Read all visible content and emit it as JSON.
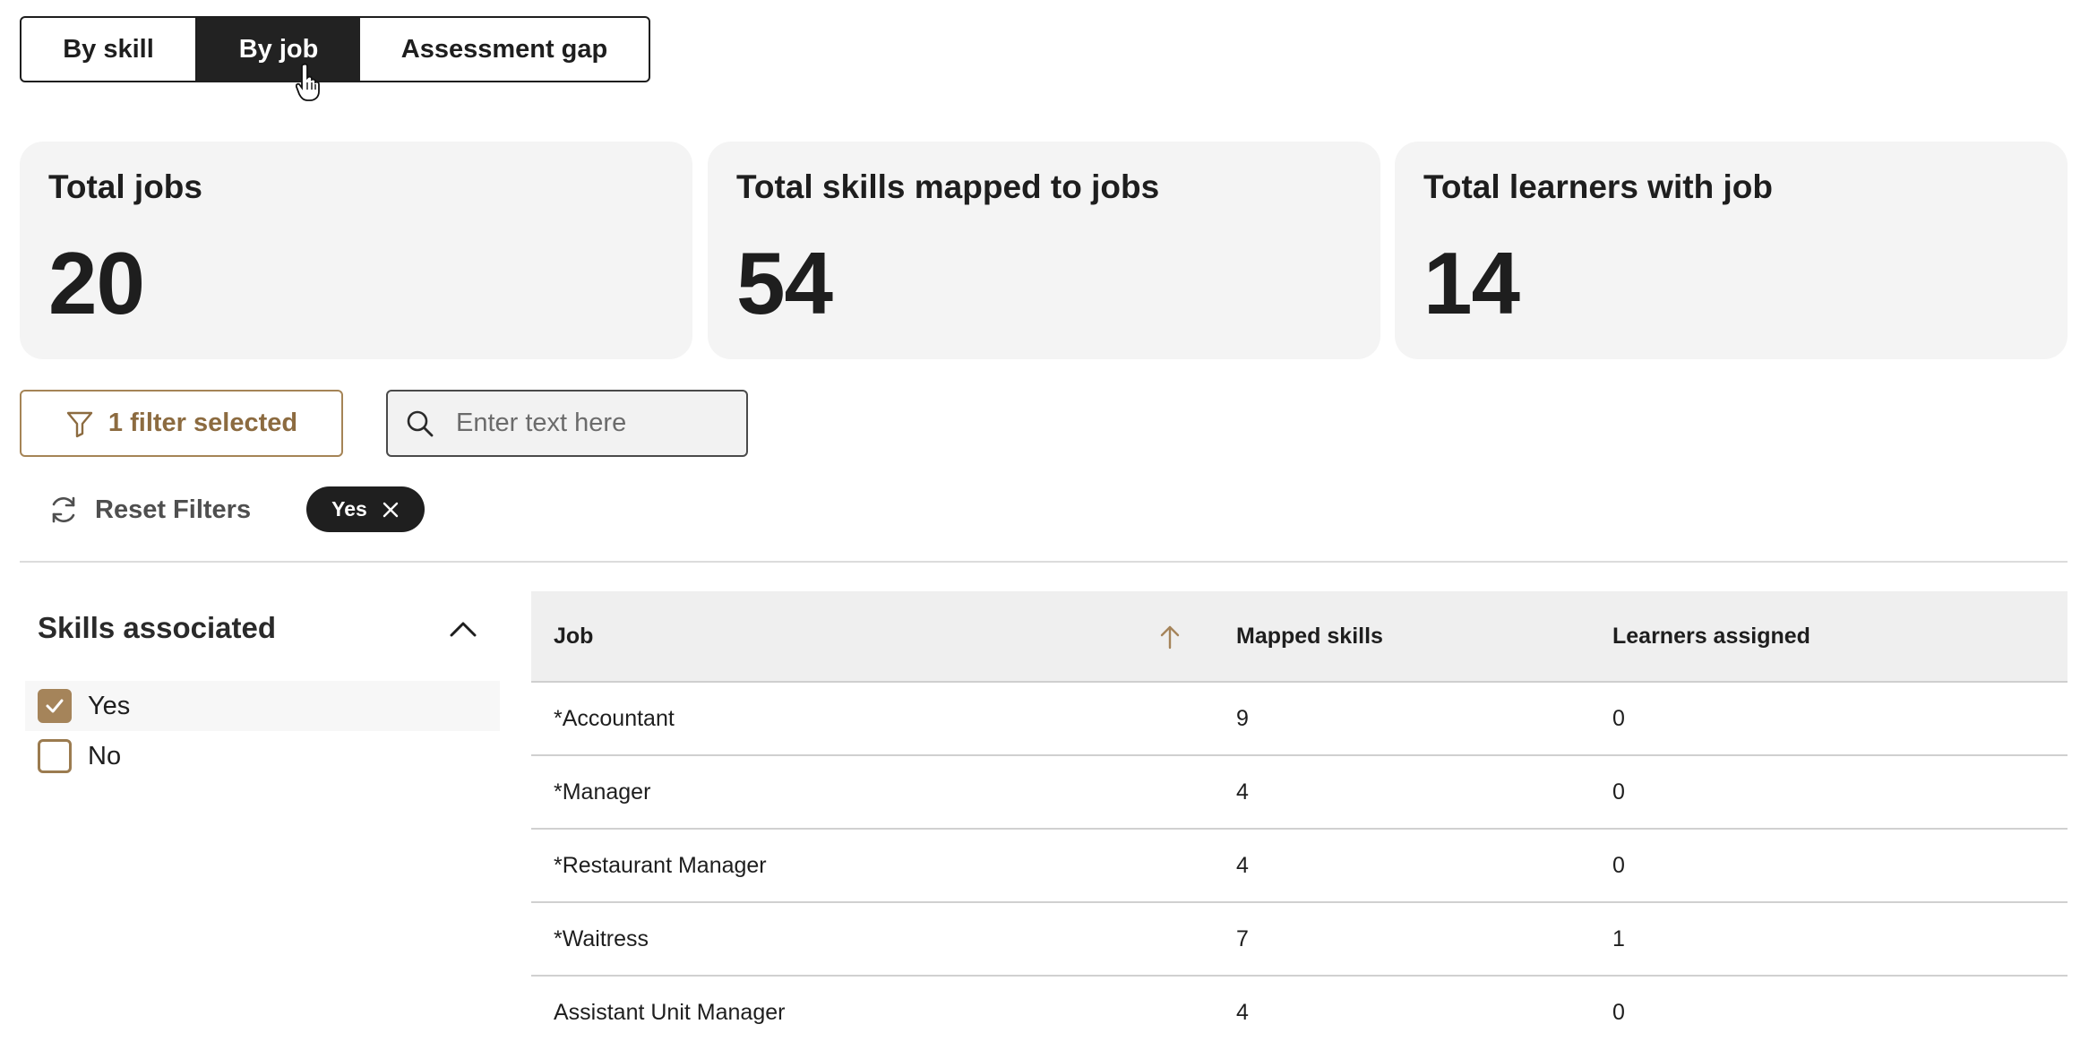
{
  "tabs": [
    {
      "label": "By skill"
    },
    {
      "label": "By job"
    },
    {
      "label": "Assessment gap"
    }
  ],
  "stats": [
    {
      "title": "Total jobs",
      "value": "20"
    },
    {
      "title": "Total skills mapped to jobs",
      "value": "54"
    },
    {
      "title": "Total learners with job",
      "value": "14"
    }
  ],
  "filters": {
    "button_label": "1 filter selected",
    "search_placeholder": "Enter text here",
    "search_value": "",
    "reset_label": "Reset Filters",
    "active_chip": "Yes"
  },
  "side_filter": {
    "heading": "Skills associated",
    "options": [
      {
        "label": "Yes",
        "checked": true
      },
      {
        "label": "No",
        "checked": false
      }
    ]
  },
  "table": {
    "columns": [
      "Job",
      "Mapped skills",
      "Learners assigned"
    ],
    "sort": {
      "column": "Job",
      "direction": "ascending"
    },
    "rows": [
      [
        "*Accountant",
        "9",
        "0"
      ],
      [
        "*Manager",
        "4",
        "0"
      ],
      [
        "*Restaurant Manager",
        "4",
        "0"
      ],
      [
        "*Waitress",
        "7",
        "1"
      ],
      [
        "Assistant Unit Manager",
        "4",
        "0"
      ]
    ]
  },
  "colors": {
    "accent": "#a5845a",
    "accent_text": "#8c6b40",
    "active_tab": "#222222",
    "card_bg": "#f4f4f4"
  },
  "icons": {
    "filter": "funnel-icon",
    "search": "magnifier-icon",
    "reset": "refresh-icon",
    "chip_close": "close-icon",
    "collapse": "chevron-up-icon",
    "sort": "arrow-up-icon",
    "checkbox": "checkmark-icon"
  }
}
